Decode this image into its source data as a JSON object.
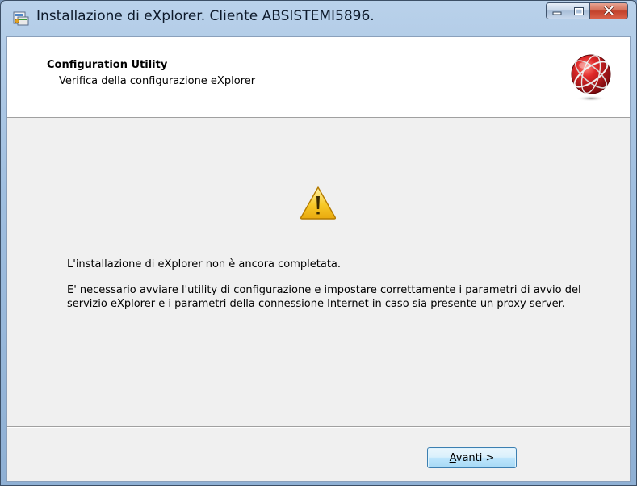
{
  "window": {
    "title": "Installazione di eXplorer. Cliente ABSISTEMI5896."
  },
  "header": {
    "title": "Configuration Utility",
    "subtitle": "Verifica della configurazione eXplorer",
    "logo_icon": "red-globe-logo-icon"
  },
  "content": {
    "warning_icon": "warning-triangle-icon",
    "message_1": "L'installazione di eXplorer non è ancora completata.",
    "message_2": "E' necessario avviare l'utility di configurazione e impostare correttamente i parametri di avvio del servizio eXplorer e i parametri della connessione Internet in caso sia presente un proxy server."
  },
  "footer": {
    "next_accel": "A",
    "next_rest": "vanti >"
  },
  "colors": {
    "close_button": "#c2402a",
    "warning_yellow": "#f5c21b",
    "logo_red": "#c8141c"
  }
}
